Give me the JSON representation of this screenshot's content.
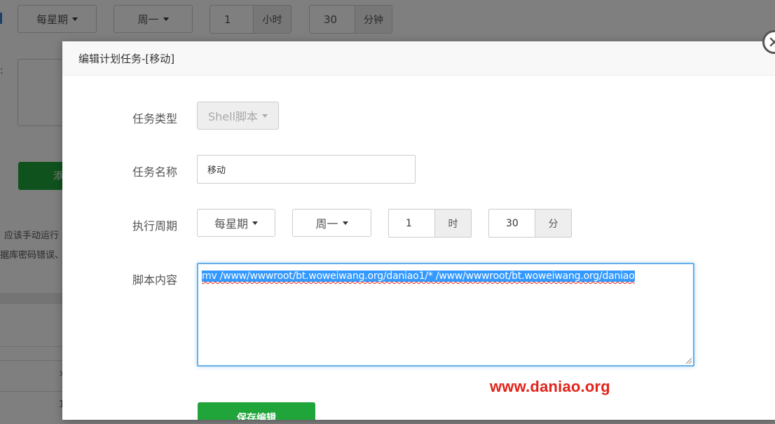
{
  "background": {
    "schedule_type": "每星期",
    "weekday": "周一",
    "hour_value": "1",
    "hour_unit": "小时",
    "minute_value": "30",
    "minute_unit": "分钟",
    "add_button_partial": "添",
    "note_line1_partial": "应该手动运行",
    "note_line2_partial": "据库密码错误、",
    "table_partial_x": "×",
    "table_partial_i": "1"
  },
  "modal": {
    "title": "编辑计划任务-[移动]",
    "task_type_label": "任务类型",
    "task_type_value": "Shell脚本",
    "task_name_label": "任务名称",
    "task_name_value": "移动",
    "period_label": "执行周期",
    "period_type": "每星期",
    "period_weekday": "周一",
    "hour_value": "1",
    "hour_unit": "时",
    "minute_value": "30",
    "minute_unit": "分",
    "script_label": "脚本内容",
    "script_value": "mv /www/wwwroot/bt.woweiwang.org/daniao1/* /www/wwwroot/bt.woweiwang.org/daniao",
    "save_button": "保存编辑"
  },
  "watermark": "www.daniao.org",
  "icons": {
    "close": "close-icon",
    "caret": "caret-down-icon"
  },
  "colors": {
    "primary_green": "#20a53a",
    "focus_blue": "#66afe9",
    "selection_blue": "#3399ff",
    "watermark_red": "#e2231a"
  }
}
